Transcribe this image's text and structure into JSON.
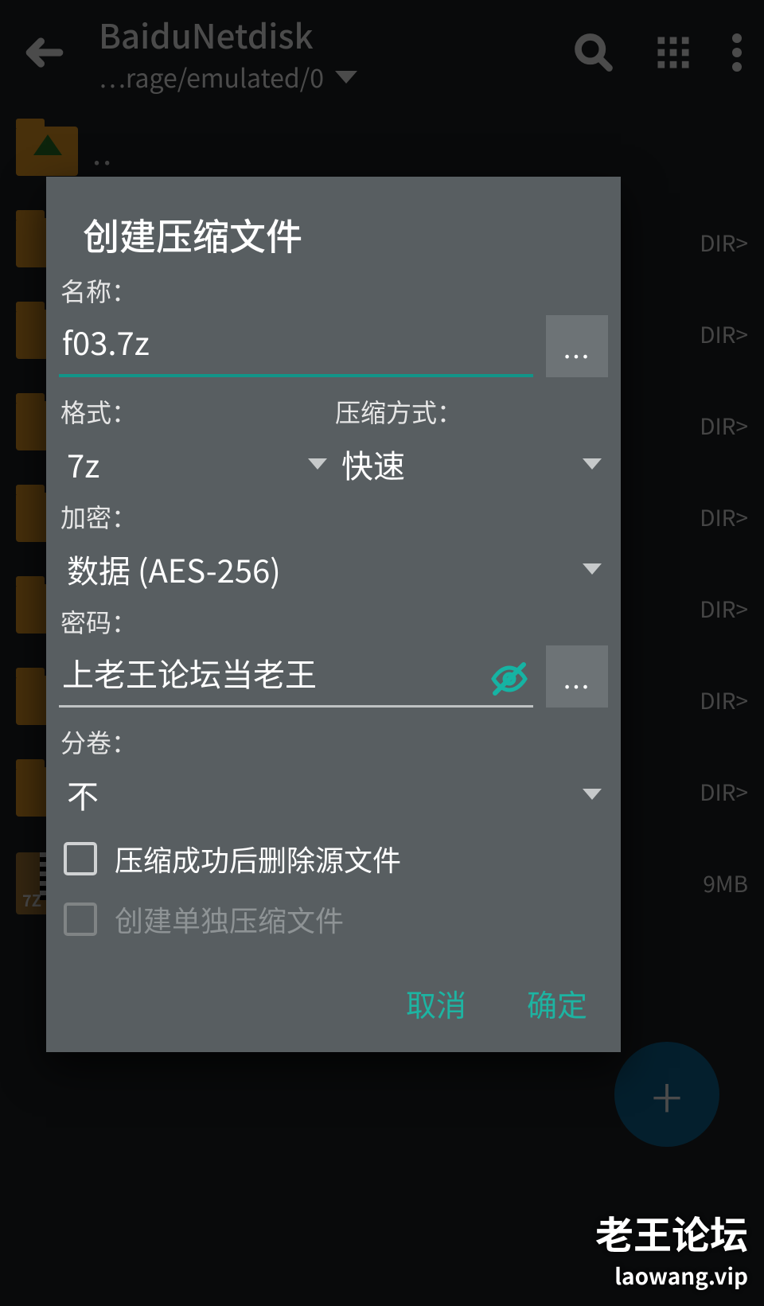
{
  "appbar": {
    "title": "BaiduNetdisk",
    "subtitle": "…rage/emulated/0"
  },
  "filelist": {
    "parent_marker": "..",
    "dir_tag": "DIR>",
    "size_tag": "9MB",
    "zip_corner_label": "7Z"
  },
  "dialog": {
    "title": "创建压缩文件",
    "name_label": "名称：",
    "name_value": "f03.7z",
    "more_button_glyph": "...",
    "format_label": "格式：",
    "format_value": "7z",
    "method_label": "压缩方式：",
    "method_value": "快速",
    "encrypt_label": "加密：",
    "encrypt_value": "数据 (AES-256)",
    "password_label": "密码：",
    "password_value": "上老王论坛当老王",
    "volume_label": "分卷：",
    "volume_value": "不",
    "delete_after_label": "压缩成功后删除源文件",
    "separate_files_label": "创建单独压缩文件",
    "cancel": "取消",
    "confirm": "确定"
  },
  "watermark": {
    "cn": "老王论坛",
    "en": "laowang.vip"
  },
  "colors": {
    "accent": "#129588",
    "dialog_bg": "#585e61",
    "folder": "#f7a627",
    "fab": "#106a9b"
  }
}
